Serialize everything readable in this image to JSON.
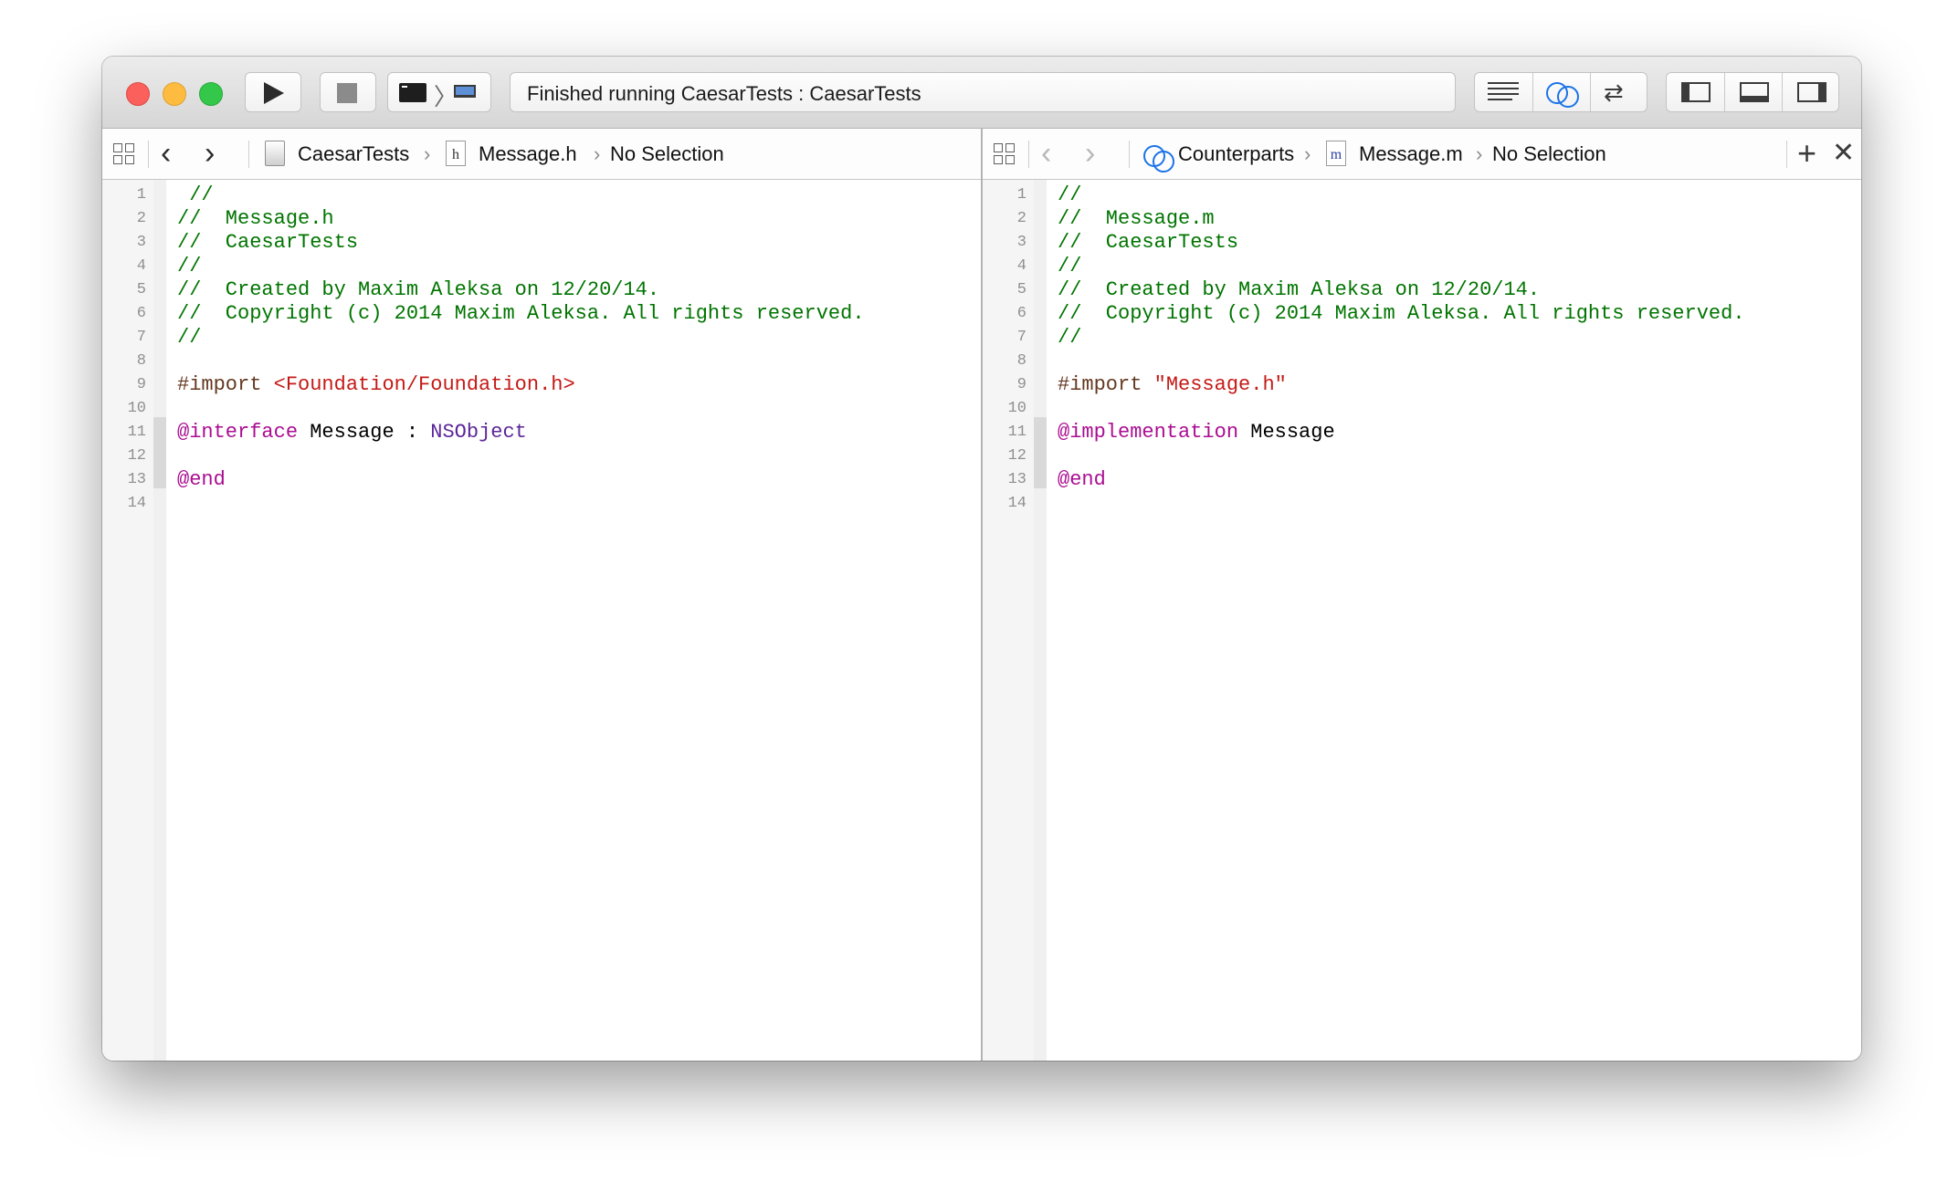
{
  "window": {
    "toolbar": {
      "traffic_lights": [
        "close",
        "minimize",
        "zoom"
      ],
      "run_icon": "play-icon",
      "stop_icon": "stop-icon",
      "scheme_icons": [
        "terminal-icon",
        "chevron-right-icon",
        "mac-icon"
      ],
      "status": "Finished running CaesarTests : CaesarTests",
      "editor_modes": [
        "standard-editor-icon",
        "assistant-editor-icon",
        "version-editor-icon"
      ],
      "view_toggles": [
        "navigator-panel-icon",
        "debug-area-icon",
        "utilities-panel-icon"
      ]
    }
  },
  "left_pane": {
    "jumpbar": {
      "project": "CaesarTests",
      "file_icon_letter": "h",
      "file": "Message.h",
      "selection": "No Selection"
    },
    "lines": [
      {
        "n": "1",
        "tokens": [
          {
            "t": " //",
            "c": "comment"
          }
        ]
      },
      {
        "n": "2",
        "tokens": [
          {
            "t": "//  Message.h",
            "c": "comment"
          }
        ]
      },
      {
        "n": "3",
        "tokens": [
          {
            "t": "//  CaesarTests",
            "c": "comment"
          }
        ]
      },
      {
        "n": "4",
        "tokens": [
          {
            "t": "//",
            "c": "comment"
          }
        ]
      },
      {
        "n": "5",
        "tokens": [
          {
            "t": "//  Created by Maxim Aleksa on 12/20/14.",
            "c": "comment"
          }
        ]
      },
      {
        "n": "6",
        "tokens": [
          {
            "t": "//  Copyright (c) 2014 Maxim Aleksa. All rights reserved.",
            "c": "comment"
          }
        ]
      },
      {
        "n": "7",
        "tokens": [
          {
            "t": "//",
            "c": "comment"
          }
        ]
      },
      {
        "n": "8",
        "tokens": []
      },
      {
        "n": "9",
        "tokens": [
          {
            "t": "#import ",
            "c": "pre"
          },
          {
            "t": "<Foundation/Foundation.h>",
            "c": "str"
          }
        ]
      },
      {
        "n": "10",
        "tokens": []
      },
      {
        "n": "11",
        "tokens": [
          {
            "t": "@interface",
            "c": "kw"
          },
          {
            "t": " Message : ",
            "c": "plain"
          },
          {
            "t": "NSObject",
            "c": "type"
          }
        ]
      },
      {
        "n": "12",
        "tokens": []
      },
      {
        "n": "13",
        "tokens": [
          {
            "t": "@end",
            "c": "kw"
          }
        ]
      },
      {
        "n": "14",
        "tokens": []
      }
    ]
  },
  "right_pane": {
    "jumpbar": {
      "mode": "Counterparts",
      "file_icon_letter": "m",
      "file": "Message.m",
      "selection": "No Selection",
      "add_icon": "+",
      "close_icon": "✕"
    },
    "lines": [
      {
        "n": "1",
        "tokens": [
          {
            "t": "//",
            "c": "comment"
          }
        ]
      },
      {
        "n": "2",
        "tokens": [
          {
            "t": "//  Message.m",
            "c": "comment"
          }
        ]
      },
      {
        "n": "3",
        "tokens": [
          {
            "t": "//  CaesarTests",
            "c": "comment"
          }
        ]
      },
      {
        "n": "4",
        "tokens": [
          {
            "t": "//",
            "c": "comment"
          }
        ]
      },
      {
        "n": "5",
        "tokens": [
          {
            "t": "//  Created by Maxim Aleksa on 12/20/14.",
            "c": "comment"
          }
        ]
      },
      {
        "n": "6",
        "tokens": [
          {
            "t": "//  Copyright (c) 2014 Maxim Aleksa. All rights reserved.",
            "c": "comment"
          }
        ]
      },
      {
        "n": "7",
        "tokens": [
          {
            "t": "//",
            "c": "comment"
          }
        ]
      },
      {
        "n": "8",
        "tokens": []
      },
      {
        "n": "9",
        "tokens": [
          {
            "t": "#import ",
            "c": "pre"
          },
          {
            "t": "\"Message.h\"",
            "c": "str"
          }
        ]
      },
      {
        "n": "10",
        "tokens": []
      },
      {
        "n": "11",
        "tokens": [
          {
            "t": "@implementation",
            "c": "kw"
          },
          {
            "t": " Message",
            "c": "plain"
          }
        ]
      },
      {
        "n": "12",
        "tokens": []
      },
      {
        "n": "13",
        "tokens": [
          {
            "t": "@end",
            "c": "kw"
          }
        ]
      },
      {
        "n": "14",
        "tokens": []
      }
    ]
  },
  "syntax_colors": {
    "comment": "#007400",
    "pre": "#643820",
    "str": "#c41a16",
    "kw": "#aa0d91",
    "type": "#5c2699",
    "plain": "#000000"
  }
}
